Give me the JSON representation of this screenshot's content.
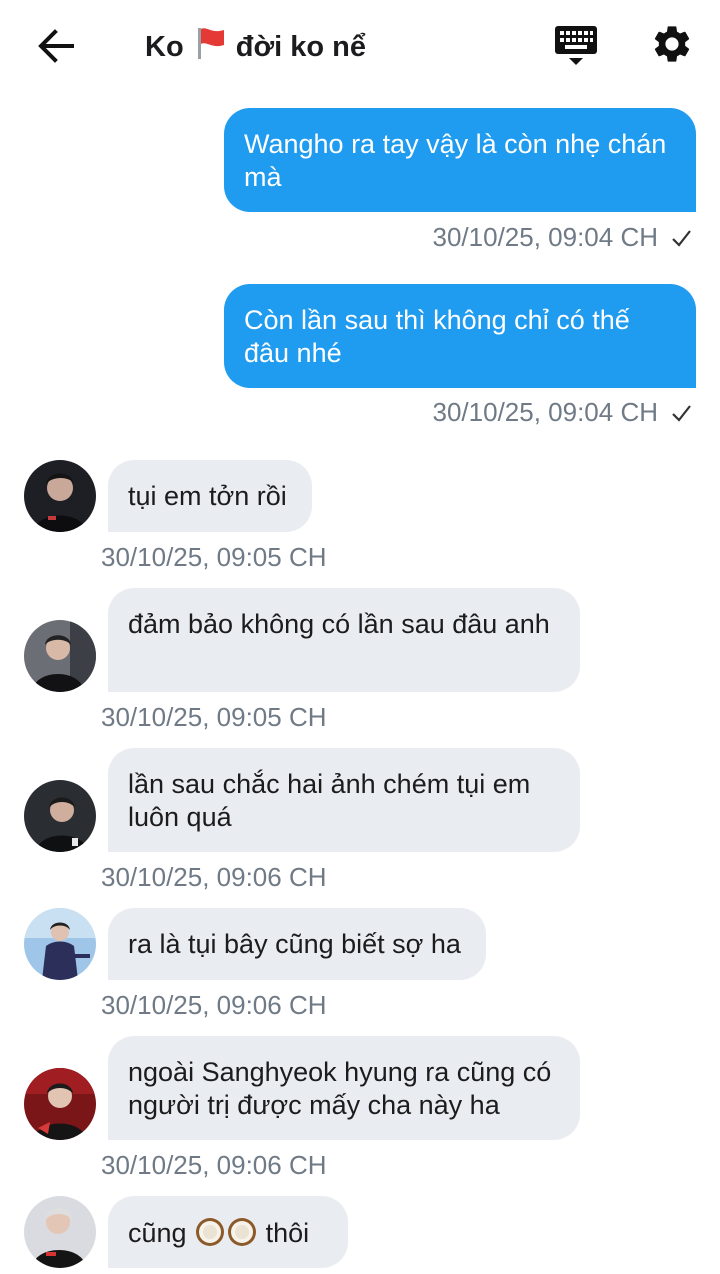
{
  "header": {
    "title_before": "Ko",
    "title_after": "đời ko nể",
    "back_icon": "arrow-left-icon",
    "keyboard_icon": "keyboard-icon",
    "settings_icon": "gear-icon"
  },
  "messages": [
    {
      "direction": "out",
      "text": "Wangho ra tay vậy là còn nhẹ chán mà",
      "time": "30/10/25, 09:04 CH",
      "status": "sent"
    },
    {
      "direction": "out",
      "text": "Còn lần sau thì không chỉ có thế đâu nhé",
      "time": "30/10/25, 09:04 CH",
      "status": "sent"
    },
    {
      "direction": "in",
      "text": "tụi em tởn rồi",
      "time": "30/10/25, 09:05 CH"
    },
    {
      "direction": "in",
      "text": "đảm bảo không có lần sau đâu anh",
      "time": "30/10/25, 09:05 CH"
    },
    {
      "direction": "in",
      "text": "lần sau chắc hai ảnh chém tụi em luôn quá",
      "time": "30/10/25, 09:06 CH"
    },
    {
      "direction": "in",
      "text": "ra là tụi bây cũng biết sợ ha",
      "time": "30/10/25, 09:06 CH"
    },
    {
      "direction": "in",
      "text": "ngoài Sanghyeok hyung ra cũng có người trị được mấy cha này ha",
      "time": "30/10/25, 09:06 CH"
    },
    {
      "direction": "in",
      "text_before": "cũng",
      "text_after": "thôi",
      "emoji": "coconut-emoji"
    }
  ],
  "colors": {
    "outgoing_bubble": "#1f9bf0",
    "incoming_bubble": "#e9ecf0",
    "timestamp": "#707a86"
  }
}
